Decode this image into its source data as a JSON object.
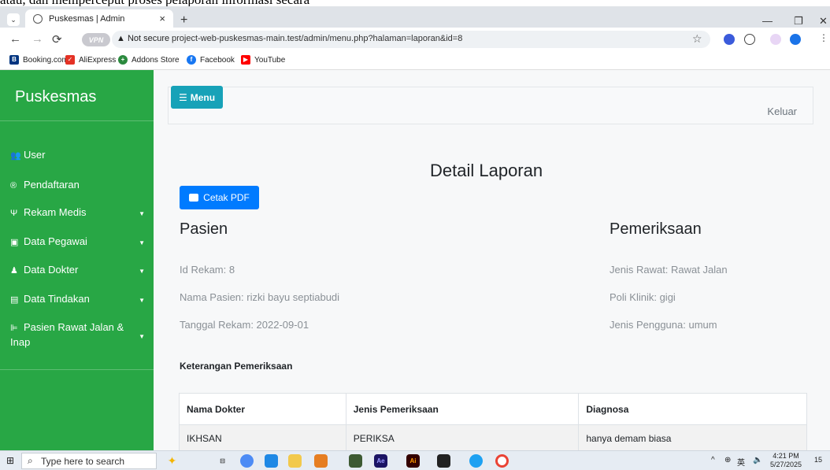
{
  "top_text": "atau, dan memperceput proses pelaporan informasi secara",
  "browser": {
    "tab_title": "Puskesmas | Admin",
    "tab_close": "×",
    "new_tab": "+",
    "tab_list": "⌄",
    "security_label": "Not secure",
    "url": "project-web-puskesmas-main.test/admin/menu.php?halaman=laporan&id=8",
    "vpn_label": "VPN",
    "bookmarks": [
      "Booking.com",
      "AliExpress",
      "Addons Store",
      "Facebook",
      "YouTube"
    ]
  },
  "sidebar": {
    "brand": "Puskesmas",
    "items": [
      {
        "label": "User",
        "icon": "users-icon",
        "has_caret": false
      },
      {
        "label": "Pendaftaran",
        "icon": "registered-icon",
        "has_caret": false
      },
      {
        "label": "Rekam Medis",
        "icon": "stethoscope-icon",
        "has_caret": true
      },
      {
        "label": "Data Pegawai",
        "icon": "id-card-icon",
        "has_caret": true
      },
      {
        "label": "Data Dokter",
        "icon": "user-doctor-icon",
        "has_caret": true
      },
      {
        "label": "Data Tindakan",
        "icon": "clinic-icon",
        "has_caret": true
      },
      {
        "label": "Pasien Rawat Jalan & Inap",
        "icon": "bed-icon",
        "has_caret": true
      }
    ]
  },
  "topbar": {
    "menu_label": "Menu",
    "logout_label": "Keluar"
  },
  "report": {
    "title": "Detail Laporan",
    "print_label": "Cetak PDF",
    "patient_heading": "Pasien",
    "exam_heading": "Pemeriksaan",
    "patient_info": [
      "Id Rekam: 8",
      "Nama Pasien: rizki bayu septiabudi",
      "Tanggal Rekam: 2022-09-01"
    ],
    "exam_info": [
      "Jenis Rawat: Rawat Jalan",
      "Poli Klinik: gigi",
      "Jenis Pengguna: umum"
    ],
    "notes_heading": "Keterangan Pemeriksaan",
    "table": {
      "headers": [
        "Nama Dokter",
        "Jenis Pemeriksaan",
        "Diagnosa"
      ],
      "rows": [
        [
          "IKHSAN",
          "PERIKSA",
          "hanya demam biasa"
        ]
      ]
    }
  },
  "taskbar": {
    "search_placeholder": "Type here to search",
    "time": "4:21 PM",
    "date": "5/27/2025",
    "notifications": "15"
  },
  "colors": {
    "sidebar": "#28a745",
    "menu_button": "#17a2b8",
    "print_button": "#007bff"
  }
}
